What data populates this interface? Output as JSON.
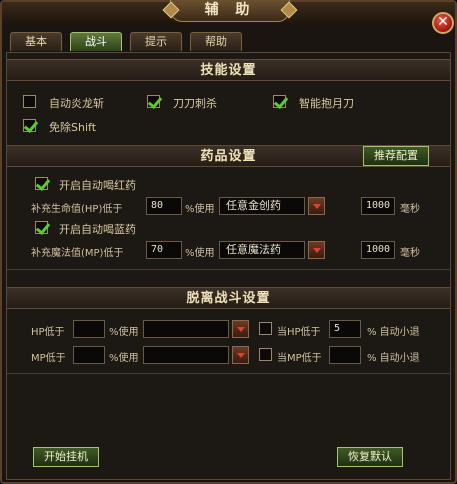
{
  "window": {
    "title": "辅 助",
    "close_icon": "close-icon"
  },
  "tabs": [
    {
      "label": "基本",
      "active": false
    },
    {
      "label": "战斗",
      "active": true
    },
    {
      "label": "提示",
      "active": false
    },
    {
      "label": "帮助",
      "active": false
    }
  ],
  "skills": {
    "header": "技能设置",
    "items": [
      {
        "label": "自动炎龙斩",
        "checked": false
      },
      {
        "label": "刀刀刺杀",
        "checked": true
      },
      {
        "label": "智能抱月刀",
        "checked": true
      },
      {
        "label": "免除Shift",
        "checked": true
      }
    ]
  },
  "potions": {
    "header": "药品设置",
    "recommend_label": "推荐配置",
    "hp": {
      "enable_label": "开启自动喝红药",
      "checked": true,
      "prefix": "补充生命值(HP)低于",
      "threshold": "80",
      "use_label": "%使用",
      "item": "任意金创药",
      "interval": "1000",
      "unit": "毫秒"
    },
    "mp": {
      "enable_label": "开启自动喝蓝药",
      "checked": true,
      "prefix": "补充魔法值(MP)低于",
      "threshold": "70",
      "use_label": "%使用",
      "item": "任意魔法药",
      "interval": "1000",
      "unit": "毫秒"
    }
  },
  "escape": {
    "header": "脱离战斗设置",
    "hp": {
      "prefix": "HP低于",
      "value": "",
      "use_label": "%使用",
      "item": "",
      "cond_label": "当HP低于",
      "cond_value": "5",
      "cond_suffix": "% 自动小退",
      "checked": false
    },
    "mp": {
      "prefix": "MP低于",
      "value": "",
      "use_label": "%使用",
      "item": "",
      "cond_label": "当MP低于",
      "cond_value": "",
      "cond_suffix": "% 自动小退",
      "checked": false
    }
  },
  "footer": {
    "start_label": "开始挂机",
    "reset_label": "恢复默认"
  }
}
